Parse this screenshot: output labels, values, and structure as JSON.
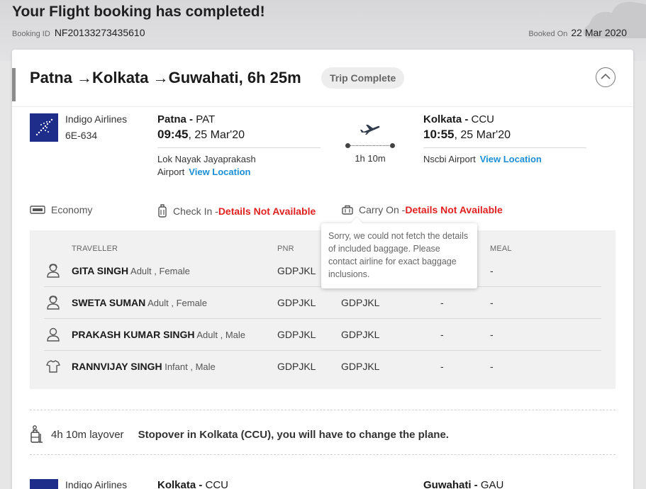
{
  "header": {
    "title": "Your Flight booking has completed!",
    "booking_id_label": "Booking ID",
    "booking_id": "NF20133273435610",
    "booked_on_label": "Booked On",
    "booked_on": "22 Mar 2020"
  },
  "trip": {
    "route": "Patna →Kolkata →Guwahati, 6h 25m",
    "status": "Trip Complete"
  },
  "segment1": {
    "airline": "Indigo Airlines",
    "flight_no": "6E-634",
    "from_city": "Patna - ",
    "from_code": "PAT",
    "dep_time": "09:45",
    "dep_date": ", 25 Mar'20",
    "dep_airport": "Lok Nayak Jayaprakash Airport",
    "duration": "1h 10m",
    "to_city": "Kolkata - ",
    "to_code": "CCU",
    "arr_time": "10:55",
    "arr_date": ", 25 Mar'20",
    "arr_airport": "Nscbi Airport",
    "view_location": "View Location"
  },
  "features": {
    "cabin": "Economy",
    "checkin_label": "Check In - ",
    "checkin_value": "Details Not Available",
    "carryon_label": "Carry On - ",
    "carryon_value": "Details Not Available"
  },
  "tooltip": {
    "text": "Sorry, we could not fetch the details of included baggage. Please contact airline for exact baggage inclusions."
  },
  "passengers": {
    "columns": [
      "TRAVELLER",
      "PNR",
      "MEAL"
    ],
    "rows": [
      {
        "name": "GITA SINGH",
        "meta": " Adult , Female",
        "pnr": "GDPJKL",
        "ticket": "",
        "seat": "",
        "meal": "-"
      },
      {
        "name": "SWETA SUMAN",
        "meta": " Adult , Female",
        "pnr": "GDPJKL",
        "ticket": "GDPJKL",
        "seat": "-",
        "meal": "-"
      },
      {
        "name": "PRAKASH KUMAR SINGH",
        "meta": " Adult , Male",
        "pnr": "GDPJKL",
        "ticket": "GDPJKL",
        "seat": "-",
        "meal": "-"
      },
      {
        "name": "RANNVIJAY SINGH",
        "meta": " Infant , Male",
        "pnr": "GDPJKL",
        "ticket": "GDPJKL",
        "seat": "-",
        "meal": "-"
      }
    ]
  },
  "layover": {
    "duration": "4h 10m layover",
    "message": "Stopover in Kolkata (CCU), you will have to change the plane."
  },
  "segment2": {
    "airline": "Indigo Airlines",
    "from_city": "Kolkata - ",
    "from_code": "CCU",
    "to_city": "Guwahati - ",
    "to_code": "GAU"
  },
  "colors": {
    "accent_blue": "#1a8fd6",
    "alert_red": "#e32020",
    "airline_navy": "#1f2d8a"
  },
  "icons": [
    "plane-icon",
    "seat-class-icon",
    "check-in-bag-icon",
    "carry-on-bag-icon",
    "adult-female-icon",
    "adult-male-icon",
    "infant-icon",
    "layover-icon",
    "chevron-up-icon",
    "airline-logo"
  ]
}
